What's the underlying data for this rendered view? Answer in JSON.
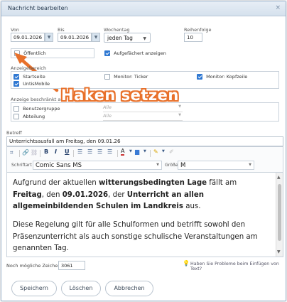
{
  "window": {
    "title": "Nachricht bearbeiten",
    "close_glyph": "×"
  },
  "schedule": {
    "von_label": "Von",
    "von_value": "09.01.2026",
    "bis_label": "Bis",
    "bis_value": "09.01.2026",
    "wochentag_label": "Wochentag",
    "wochentag_value": "jeden Tag",
    "reihenfolge_label": "Reihenfolge",
    "reihenfolge_value": "10"
  },
  "flags": {
    "oeffentlich_label": "Öffentlich",
    "oeffentlich_checked": false,
    "aufgefaechert_label": "Aufgefächert anzeigen",
    "aufgefaechert_checked": true
  },
  "anzeigebereich": {
    "label": "Anzeigebereich",
    "items": [
      {
        "label": "Startseite",
        "checked": true
      },
      {
        "label": "Monitor: Ticker",
        "checked": false
      },
      {
        "label": "Monitor: Kopfzeile",
        "checked": true
      },
      {
        "label": "UntisMobile",
        "checked": true
      }
    ]
  },
  "anzeige_beschraenkt": {
    "label": "Anzeige beschränkt auf",
    "benutzergruppe_label": "Benutzergruppe",
    "benutzergruppe_value": "Alle",
    "abteilung_label": "Abteilung",
    "abteilung_value": "Alle"
  },
  "annotation": {
    "text": "Haken setzen",
    "color": "#e8702a"
  },
  "betreff": {
    "label": "Betreff",
    "value": "Unterrichtsausfall am Freitag, den 09.01.26"
  },
  "toolbar": {
    "schriftart_label": "Schriftart",
    "schriftart_value": "Comic Sans MS",
    "groesse_label": "Größe",
    "groesse_value": "M",
    "bold": "B",
    "italic": "I",
    "underline": "U"
  },
  "editor": {
    "p1_a": "Aufgrund der aktuellen ",
    "p1_b": "witterungsbedingten Lage",
    "p1_c": " fällt am ",
    "p1_d": "Freitag",
    "p1_e": ", den ",
    "p1_f": "09.01.2026",
    "p1_g": ", der ",
    "p1_h": "Unterricht an allen allgemeinbildenden Schulen im Landkreis",
    "p1_i": " aus.",
    "p2": "Diese Regelung gilt für alle Schulformen und betrifft sowohl den Präsenzunterricht als auch sonstige schulische Veranstaltungen am genannten Tag."
  },
  "footer": {
    "remaining_label": "Noch mögliche Zeichen:",
    "remaining_value": "3061",
    "help_link": "Haben Sie Probleme beim Einfügen von Text?"
  },
  "buttons": {
    "save": "Speichern",
    "delete": "Löschen",
    "cancel": "Abbrechen"
  }
}
